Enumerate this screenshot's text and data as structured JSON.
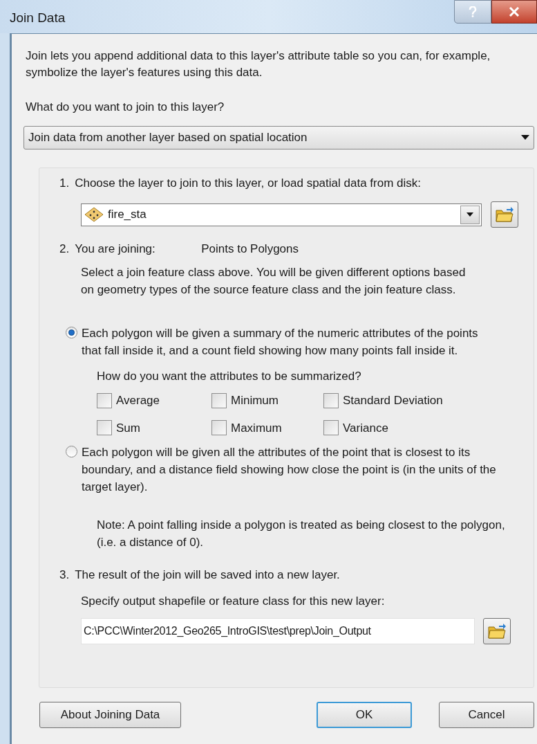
{
  "window": {
    "title": "Join Data"
  },
  "intro": "Join lets you append additional data to this layer's attribute table so you can, for example, symbolize the layer's features using this data.",
  "question": "What do you want to join to this layer?",
  "join_type": {
    "value": "Join data from another layer based on spatial location"
  },
  "step1": {
    "number": "1.",
    "label": "Choose the layer to join to this layer, or load spatial data from disk:",
    "layer": "fire_sta"
  },
  "step2": {
    "number": "2.",
    "label": "You are joining:",
    "value": "Points to Polygons",
    "description": "Select a join feature class above.  You will be given different options based on geometry types of the source feature class and the join feature class.",
    "options": [
      {
        "label": "Each polygon will be given a summary of the numeric attributes of the points that fall inside it, and a count field showing how many points fall inside it.",
        "selected": true
      },
      {
        "label": "Each polygon will be given all the attributes of the point that is closest to its boundary, and a distance field showing how close the point is (in the units of the target layer).",
        "selected": false
      }
    ],
    "summary_question": "How do you want the attributes to be summarized?",
    "summaries": [
      {
        "label": "Average",
        "checked": false
      },
      {
        "label": "Minimum",
        "checked": false
      },
      {
        "label": "Standard Deviation",
        "checked": false
      },
      {
        "label": "Sum",
        "checked": false
      },
      {
        "label": "Maximum",
        "checked": false
      },
      {
        "label": "Variance",
        "checked": false
      }
    ],
    "note": "Note: A point falling inside a polygon is treated as being closest to the polygon, (i.e. a distance of 0)."
  },
  "step3": {
    "number": "3.",
    "label": "The result of the join will be saved into a new layer.",
    "specify": "Specify output shapefile or feature class for this new layer:",
    "output": "C:\\PCC\\Winter2012_Geo265_IntroGIS\\test\\prep\\Join_Output"
  },
  "buttons": [
    {
      "label": "About Joining Data",
      "default": false
    },
    {
      "label": "OK",
      "default": true
    },
    {
      "label": "Cancel",
      "default": false
    }
  ]
}
